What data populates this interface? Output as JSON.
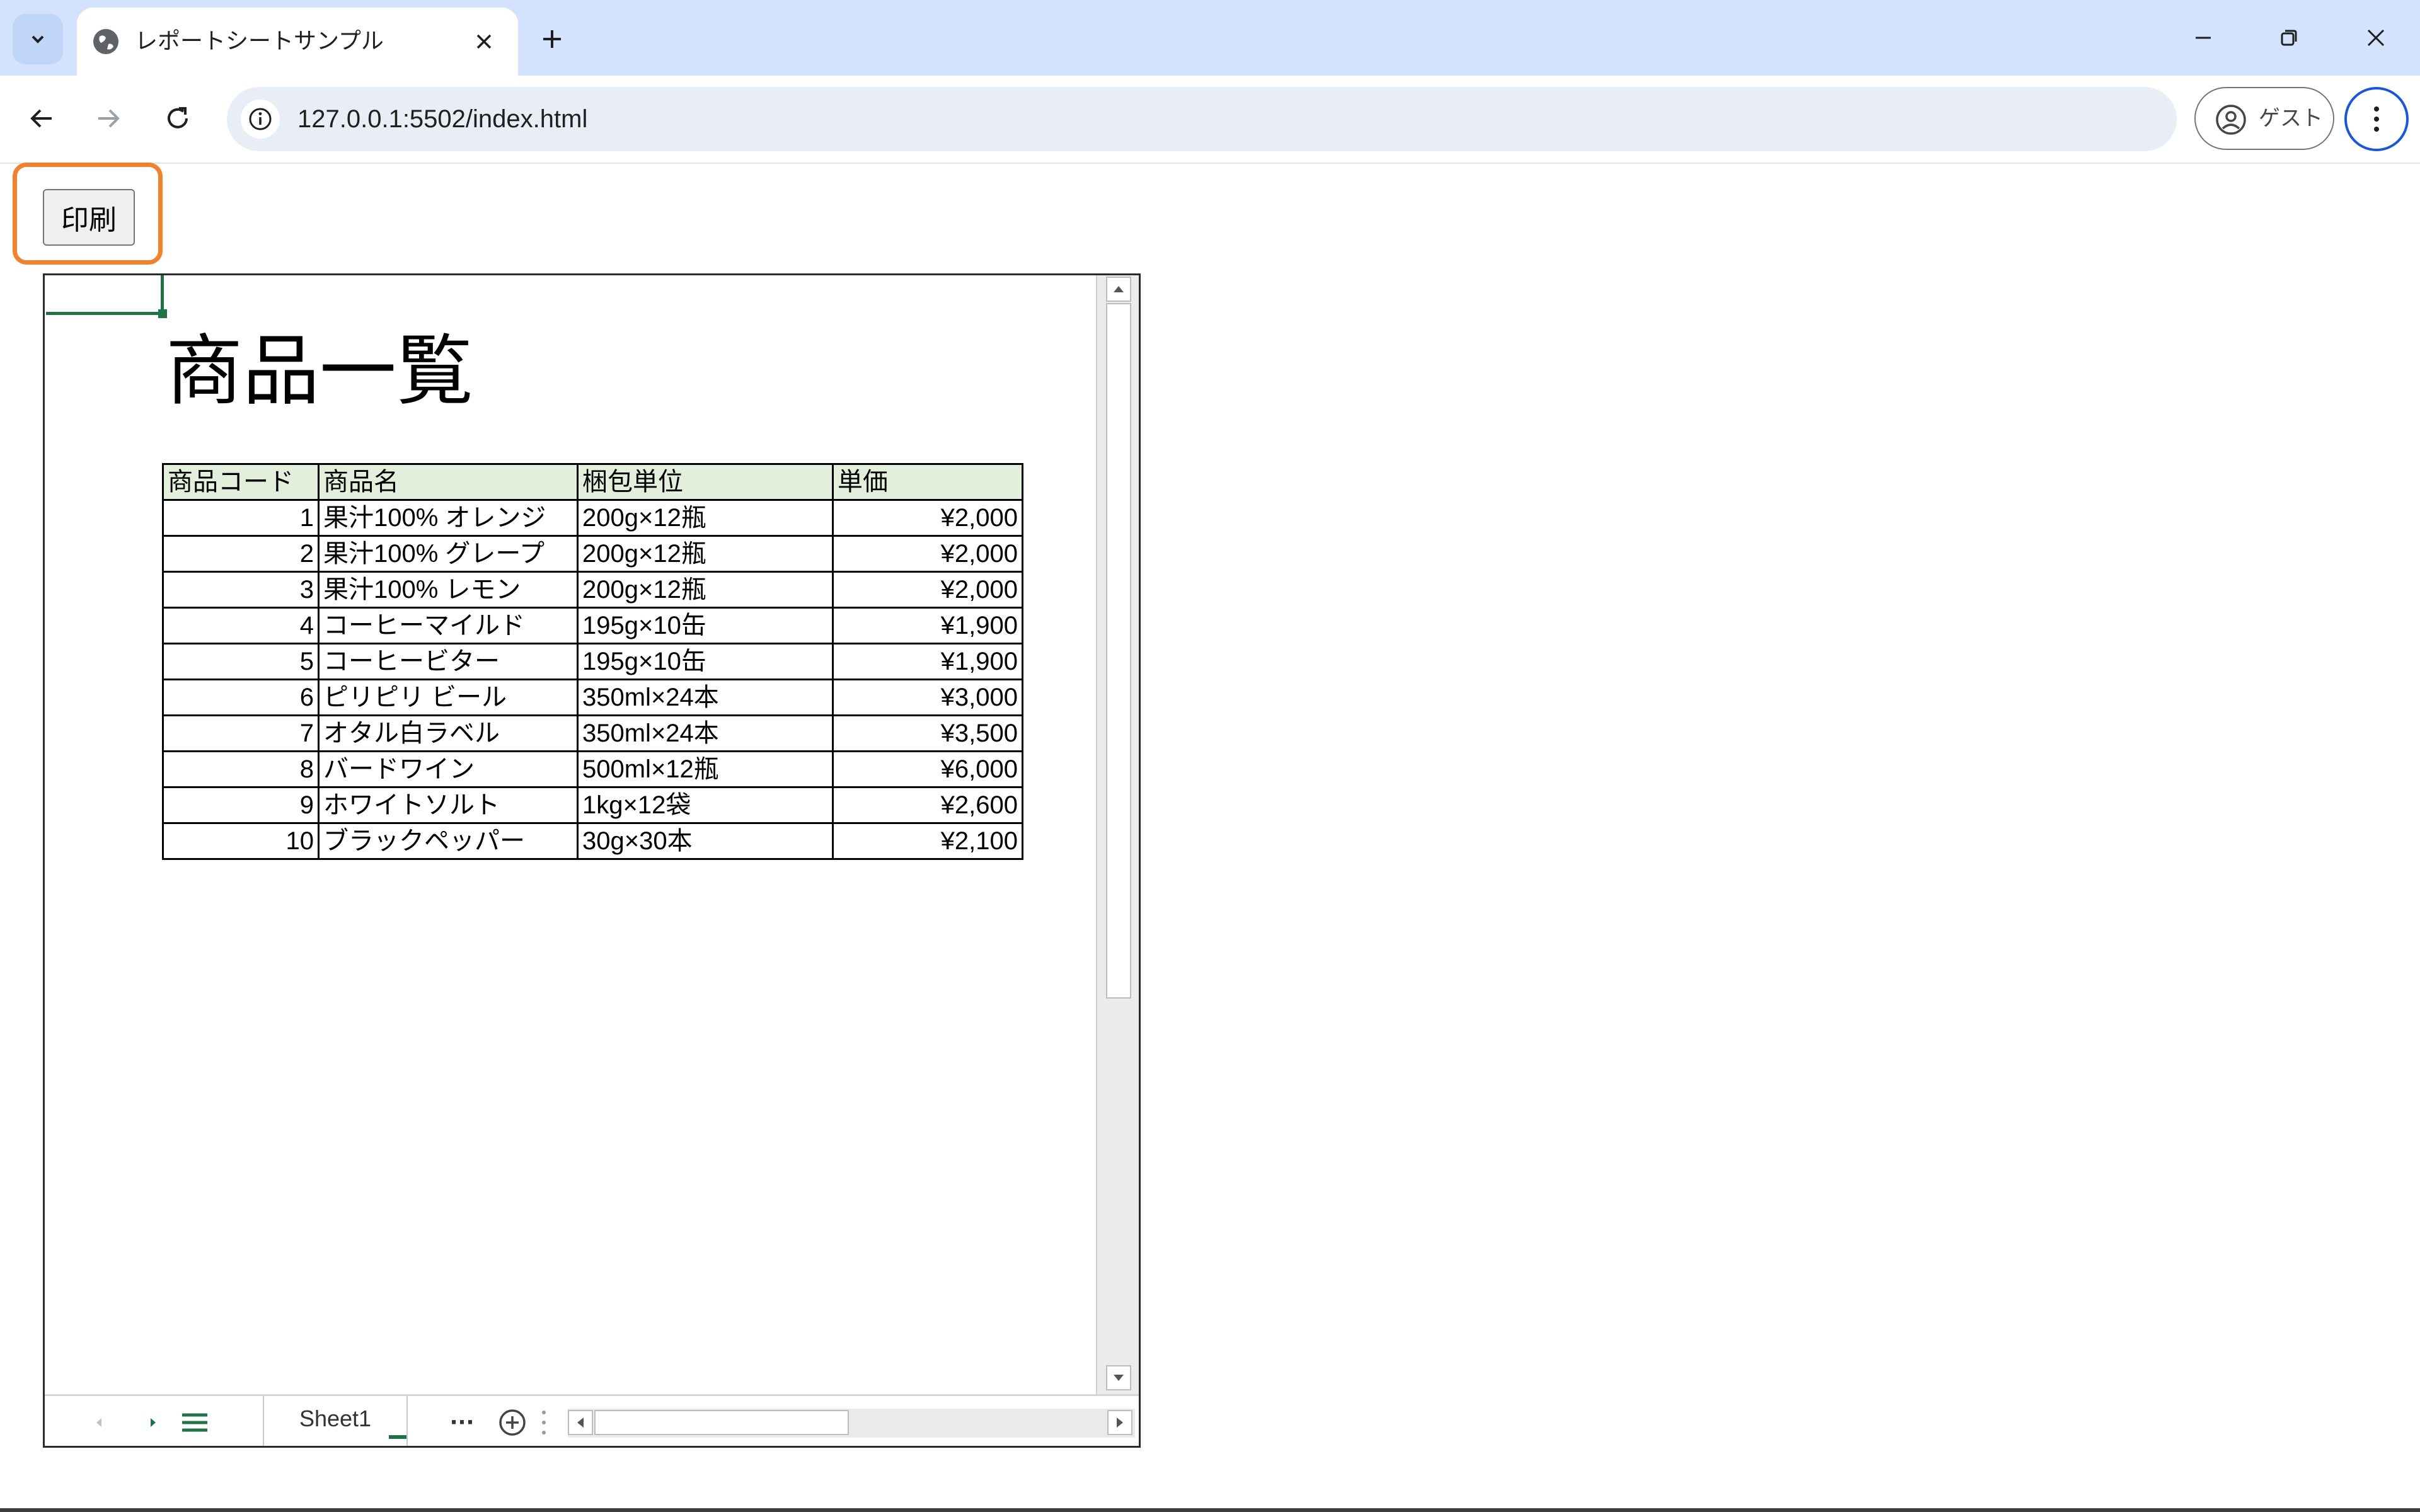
{
  "browser": {
    "tab_title": "レポートシートサンプル",
    "url": "127.0.0.1:5502/index.html",
    "profile_label": "ゲスト"
  },
  "page": {
    "print_button": "印刷"
  },
  "sheet": {
    "title": "商品一覧",
    "headers": [
      "商品コード",
      "商品名",
      "梱包単位",
      "単価"
    ],
    "rows": [
      {
        "code": "1",
        "name": "果汁100% オレンジ",
        "pack": "200g×12瓶",
        "price": "¥2,000"
      },
      {
        "code": "2",
        "name": "果汁100% グレープ",
        "pack": "200g×12瓶",
        "price": "¥2,000"
      },
      {
        "code": "3",
        "name": "果汁100% レモン",
        "pack": "200g×12瓶",
        "price": "¥2,000"
      },
      {
        "code": "4",
        "name": "コーヒーマイルド",
        "pack": "195g×10缶",
        "price": "¥1,900"
      },
      {
        "code": "5",
        "name": "コーヒービター",
        "pack": "195g×10缶",
        "price": "¥1,900"
      },
      {
        "code": "6",
        "name": "ピリピリ ビール",
        "pack": "350ml×24本",
        "price": "¥3,000"
      },
      {
        "code": "7",
        "name": "オタル白ラベル",
        "pack": "350ml×24本",
        "price": "¥3,500"
      },
      {
        "code": "8",
        "name": "バードワイン",
        "pack": "500ml×12瓶",
        "price": "¥6,000"
      },
      {
        "code": "9",
        "name": "ホワイトソルト",
        "pack": "1kg×12袋",
        "price": "¥2,600"
      },
      {
        "code": "10",
        "name": "ブラックペッパー",
        "pack": "30g×30本",
        "price": "¥2,100"
      }
    ],
    "sheet_tab": "Sheet1",
    "more_tabs": "···"
  },
  "colors": {
    "excel_green": "#217346",
    "header_fill": "#e2efda",
    "highlight": "#f0822f",
    "tabstrip": "#d3e3fd"
  }
}
